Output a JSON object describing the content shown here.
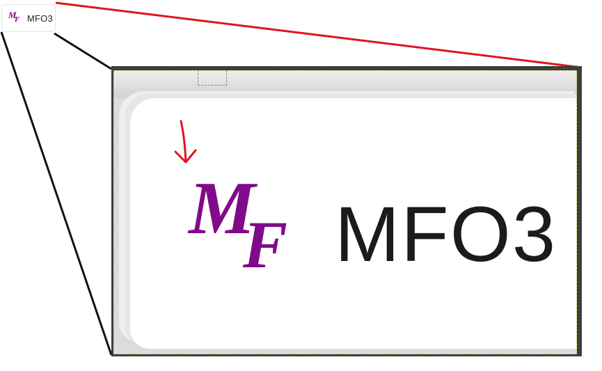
{
  "button": {
    "label": "MFO3",
    "logo_letters": {
      "top": "M",
      "bottom": "F"
    }
  },
  "zoom": {
    "label": "MFO3",
    "logo_letters": {
      "top": "M",
      "bottom": "F"
    }
  },
  "colors": {
    "logo": "#800b8a",
    "connector_red": "#e0141e",
    "connector_black": "#111111",
    "arrow": "#e0141e"
  },
  "icons": {
    "logo": "mf-logo-icon",
    "arrow": "down-right-arrow"
  }
}
